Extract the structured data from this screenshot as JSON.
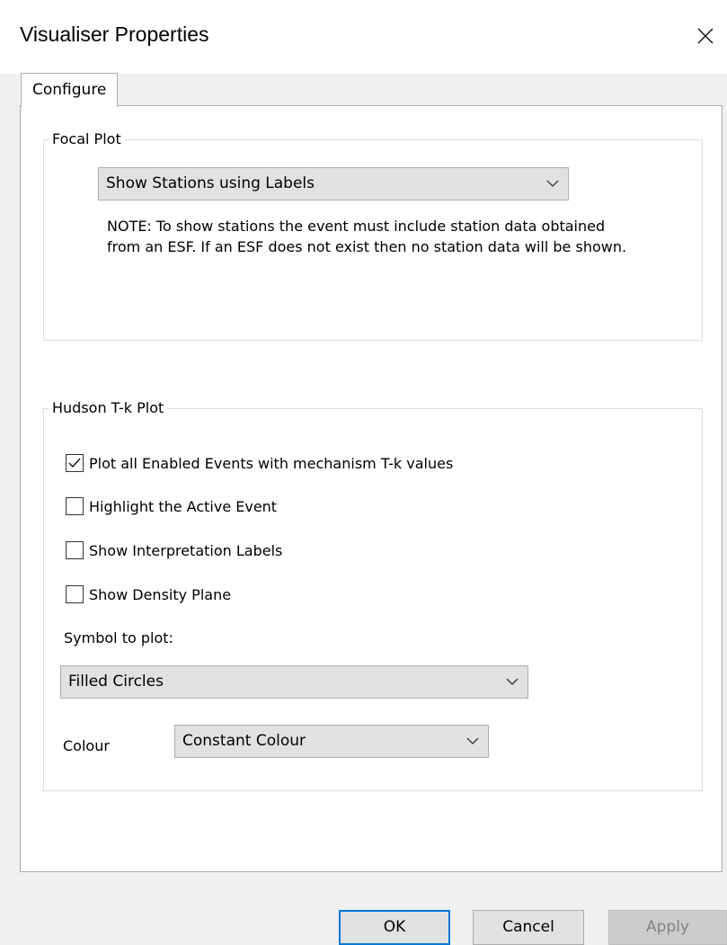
{
  "window": {
    "title": "Visualiser Properties"
  },
  "tabs": [
    {
      "label": "Configure",
      "active": true
    }
  ],
  "focal_plot": {
    "group_label": "Focal Plot",
    "display_mode": {
      "selected": "Show Stations using Labels"
    },
    "note": "NOTE: To show stations the event must include station data obtained from an ESF. If an ESF does not exist then no station data will be shown."
  },
  "hudson_plot": {
    "group_label": "Hudson T-k Plot",
    "checkboxes": [
      {
        "label": "Plot all Enabled Events with mechanism T-k values",
        "checked": true
      },
      {
        "label": "Highlight the Active Event",
        "checked": false
      },
      {
        "label": "Show Interpretation Labels",
        "checked": false
      },
      {
        "label": "Show Density Plane",
        "checked": false
      }
    ],
    "symbol_label": "Symbol to plot:",
    "symbol": {
      "selected": "Filled Circles"
    },
    "colour_label": "Colour",
    "colour": {
      "selected": "Constant Colour"
    }
  },
  "buttons": {
    "ok": "OK",
    "cancel": "Cancel",
    "apply": "Apply"
  },
  "colors": {
    "accent": "#0078d7",
    "panel_background": "#ffffff",
    "dialog_background": "#f0f0f0",
    "disabled_text": "#838383"
  },
  "icons": {
    "close": "close-icon",
    "dropdown": "chevron-down-icon",
    "check": "checkmark-icon"
  }
}
